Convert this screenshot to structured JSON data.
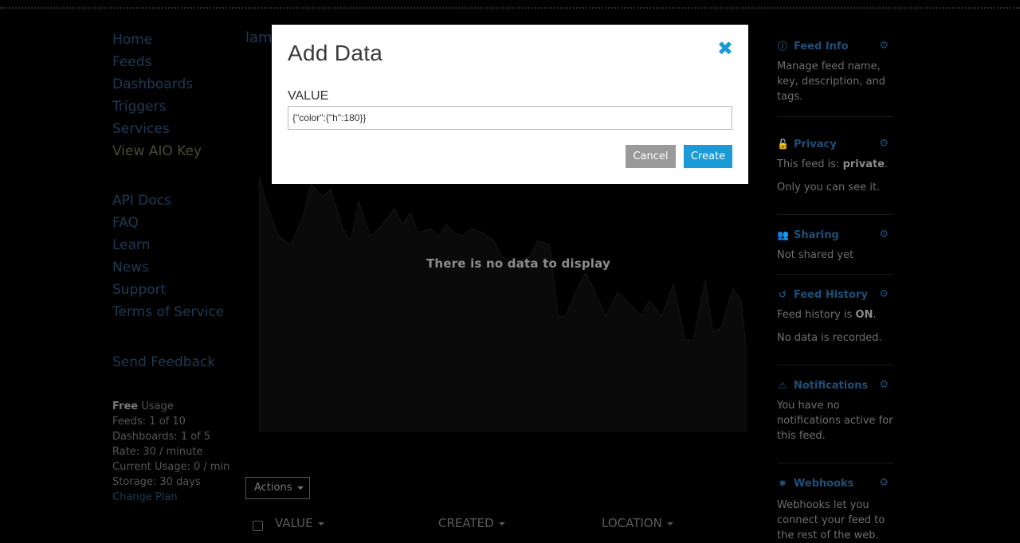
{
  "nav": {
    "primary": [
      "Home",
      "Feeds",
      "Dashboards",
      "Triggers",
      "Services",
      "View AIO Key"
    ],
    "secondary": [
      "API Docs",
      "FAQ",
      "Learn",
      "News",
      "Support",
      "Terms of Service"
    ],
    "feedback": "Send Feedback"
  },
  "usage": {
    "plan": "Free",
    "plan_suffix": " Usage",
    "feeds": "Feeds: 1 of 10",
    "dashboards": "Dashboards: 1 of 5",
    "rate": "Rate: 30 / minute",
    "current": "Current Usage: 0 / min",
    "storage": "Storage: 30 days",
    "change_plan": "Change Plan"
  },
  "feed": {
    "title_partial": "lam",
    "no_data": "There is no data to display",
    "actions_label": "Actions",
    "columns": [
      "VALUE",
      "CREATED",
      "LOCATION"
    ]
  },
  "sidebar": {
    "feed_info": {
      "title": "Feed Info",
      "text": "Manage feed name, key, description, and tags."
    },
    "privacy": {
      "title": "Privacy",
      "text_prefix": "This feed is: ",
      "status": "private",
      "text_suffix": ".",
      "note": "Only you can see it."
    },
    "sharing": {
      "title": "Sharing",
      "text": "Not shared yet"
    },
    "history": {
      "title": "Feed History",
      "text_prefix": "Feed history is ",
      "status": "ON",
      "text_suffix": ".",
      "note": "No data is recorded."
    },
    "notifications": {
      "title": "Notifications",
      "text": "You have no notifications active for this feed."
    },
    "webhooks": {
      "title": "Webhooks",
      "text": "Webhooks let you connect your feed to the rest of the web."
    }
  },
  "modal": {
    "title": "Add Data",
    "field_label": "VALUE",
    "field_value": "{\"color\":{\"h\":180}}",
    "cancel": "Cancel",
    "create": "Create"
  },
  "colors": {
    "accent": "#1a9ad6",
    "cancel": "#9a9a9a",
    "link": "#1c3a55"
  }
}
